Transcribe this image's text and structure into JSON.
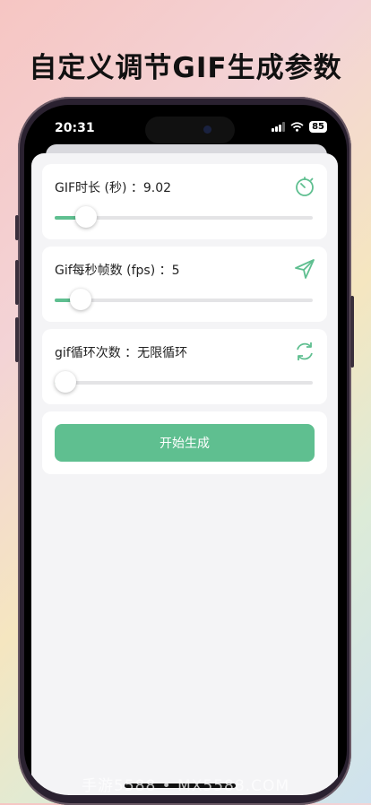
{
  "banner": {
    "title": "自定义调节GIF生成参数"
  },
  "status_bar": {
    "time": "20:31",
    "battery": "85"
  },
  "settings": [
    {
      "label": "GIF时长 (秒) ：9.02",
      "icon": "timer-icon",
      "slider_fraction": 0.12
    },
    {
      "label": "Gif每秒帧数 (fps) ：5",
      "icon": "send-icon",
      "slider_fraction": 0.1
    },
    {
      "label": "gif循环次数 ：无限循环",
      "icon": "refresh-icon",
      "slider_fraction": 0.04
    }
  ],
  "generate_button": {
    "label": "开始生成"
  },
  "watermark": "手游5588 • MX5588.COM",
  "colors": {
    "accent": "#5fbf90",
    "sheet_bg": "#f4f4f6",
    "card_bg": "#ffffff"
  }
}
